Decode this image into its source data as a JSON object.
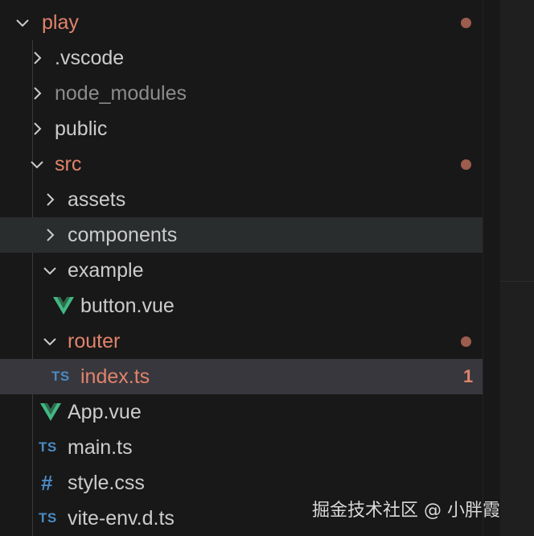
{
  "tree": {
    "root": {
      "label": "play",
      "expanded": true,
      "modified": true
    },
    "items": {
      "vscode": {
        "label": ".vscode"
      },
      "node_modules": {
        "label": "node_modules"
      },
      "public": {
        "label": "public"
      },
      "src": {
        "label": "src",
        "modified": true
      },
      "assets": {
        "label": "assets"
      },
      "components": {
        "label": "components"
      },
      "example": {
        "label": "example"
      },
      "button_vue": {
        "label": "button.vue"
      },
      "router": {
        "label": "router",
        "modified": true
      },
      "index_ts": {
        "label": "index.ts",
        "problem_count": "1"
      },
      "app_vue": {
        "label": "App.vue"
      },
      "main_ts": {
        "label": "main.ts"
      },
      "style_css": {
        "label": "style.css"
      },
      "vite_env": {
        "label": "vite-env.d.ts"
      }
    },
    "icon_text": {
      "ts": "TS",
      "css": "#"
    }
  },
  "colors": {
    "background": "#181818",
    "modified_text": "#e2836b",
    "modified_dot": "#9c5c4e",
    "ts_icon": "#4b8ac4",
    "vue_green": "#41b883"
  },
  "icons": {
    "chevron_down": "chevron-down-icon",
    "chevron_right": "chevron-right-icon",
    "vue": "vue-icon",
    "typescript": "typescript-icon",
    "css": "css-icon"
  },
  "watermark": "掘金技术社区 @ 小胖霞"
}
